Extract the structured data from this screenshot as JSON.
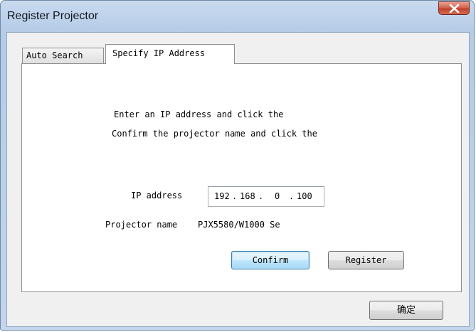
{
  "window": {
    "title": "Register Projector"
  },
  "tabs": [
    {
      "label": "Auto Search",
      "selected": false
    },
    {
      "label": "Specify IP Address",
      "selected": true
    }
  ],
  "instructions": {
    "line1": "Enter an IP address and click the",
    "line2": "Confirm the projector name and click the"
  },
  "ip": {
    "label": "IP address",
    "octets": [
      "192",
      "168",
      "0",
      "100"
    ],
    "dot1": ".",
    "dot2": ".",
    "dot3": "."
  },
  "projector": {
    "label": "Projector name",
    "value": "PJX5580/W1000 Se"
  },
  "buttons": {
    "confirm": "Confirm",
    "register": "Register",
    "ok": "确定"
  },
  "icons": {
    "close": "close-icon"
  },
  "colors": {
    "title_bar": "#bcd0ea",
    "close_button": "#c0402a",
    "default_button_border": "#3c7fb1"
  }
}
